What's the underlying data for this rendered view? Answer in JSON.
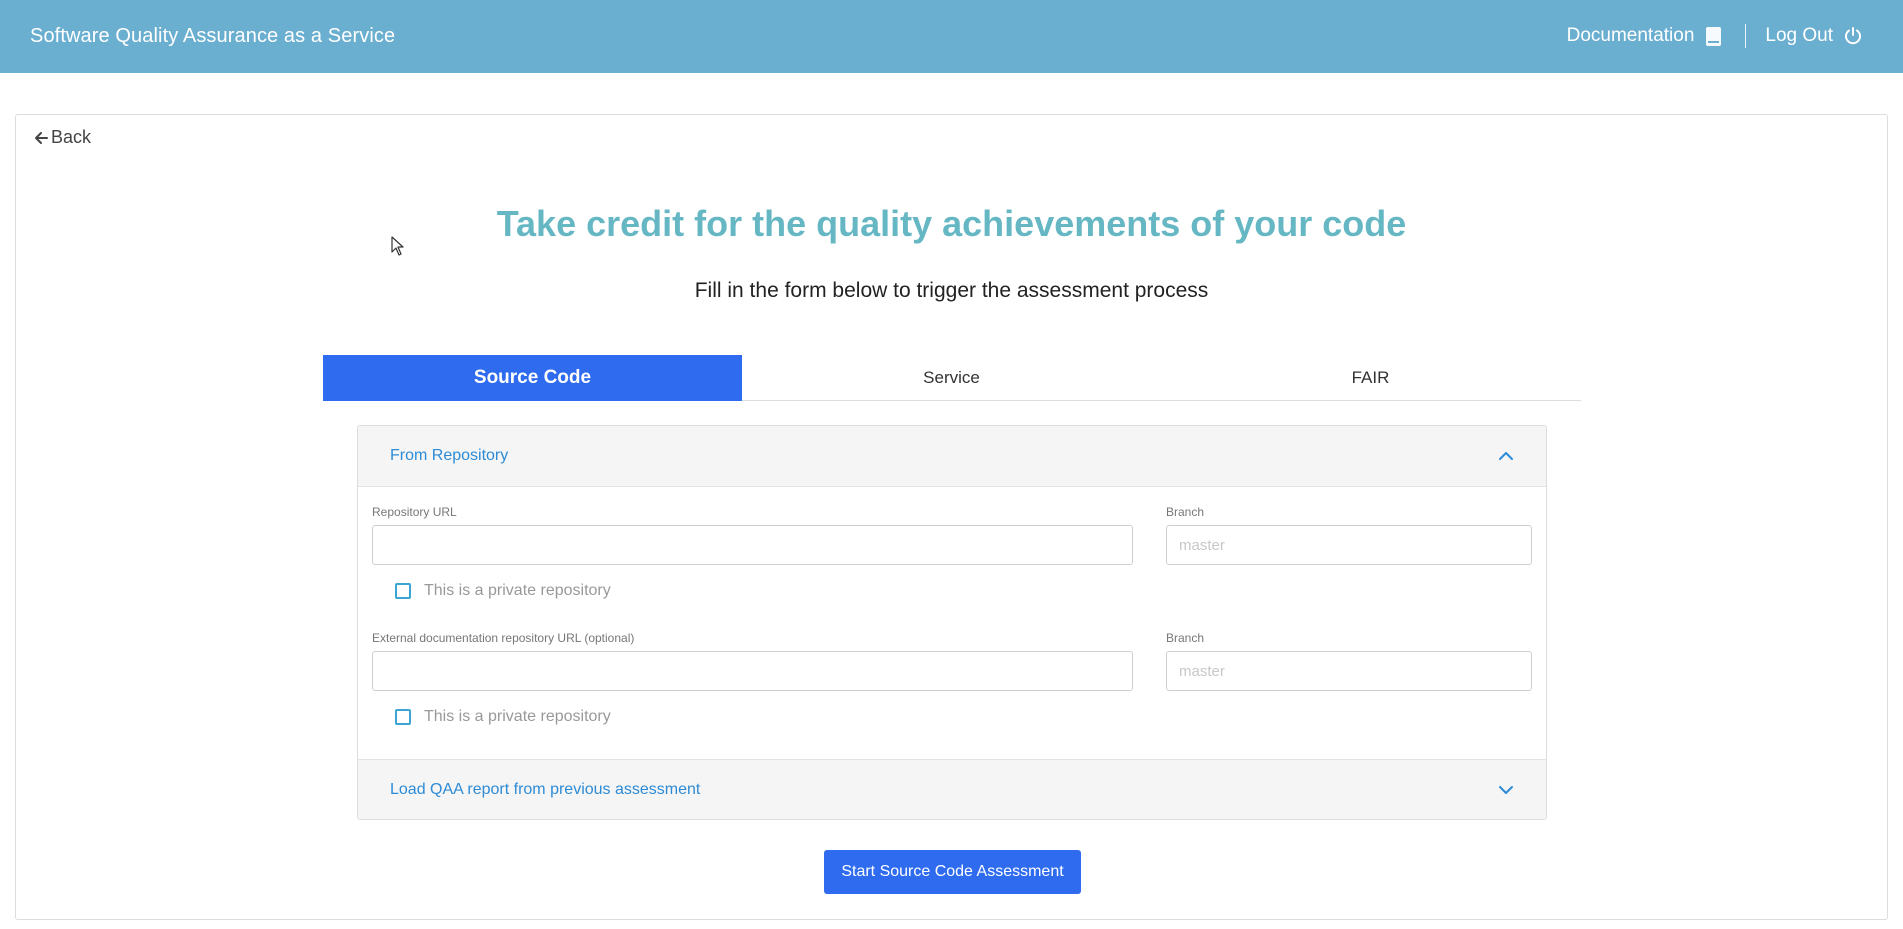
{
  "header": {
    "title": "Software Quality Assurance as a Service",
    "documentation_label": "Documentation",
    "logout_label": "Log Out"
  },
  "back_label": "Back",
  "hero": {
    "title": "Take credit for the quality achievements of your code",
    "subtitle": "Fill in the form below to trigger the assessment process"
  },
  "tabs": [
    {
      "label": "Source Code",
      "active": true
    },
    {
      "label": "Service",
      "active": false
    },
    {
      "label": "FAIR",
      "active": false
    }
  ],
  "accordion": {
    "from_repository_label": "From Repository",
    "repo_url_label": "Repository URL",
    "repo_url_value": "",
    "branch_label": "Branch",
    "branch_placeholder": "master",
    "private_repo_label": "This is a private repository",
    "ext_doc_url_label": "External documentation repository URL (optional)",
    "ext_doc_url_value": "",
    "ext_branch_label": "Branch",
    "ext_branch_placeholder": "master",
    "ext_private_repo_label": "This is a private repository",
    "load_report_label": "Load QAA report from previous assessment"
  },
  "start_button_label": "Start Source Code Assessment",
  "colors": {
    "navbar": "#6aaed0",
    "accent_blue": "#2e6bee",
    "title_teal": "#66b7c4",
    "link_blue": "#2d8bd6"
  }
}
